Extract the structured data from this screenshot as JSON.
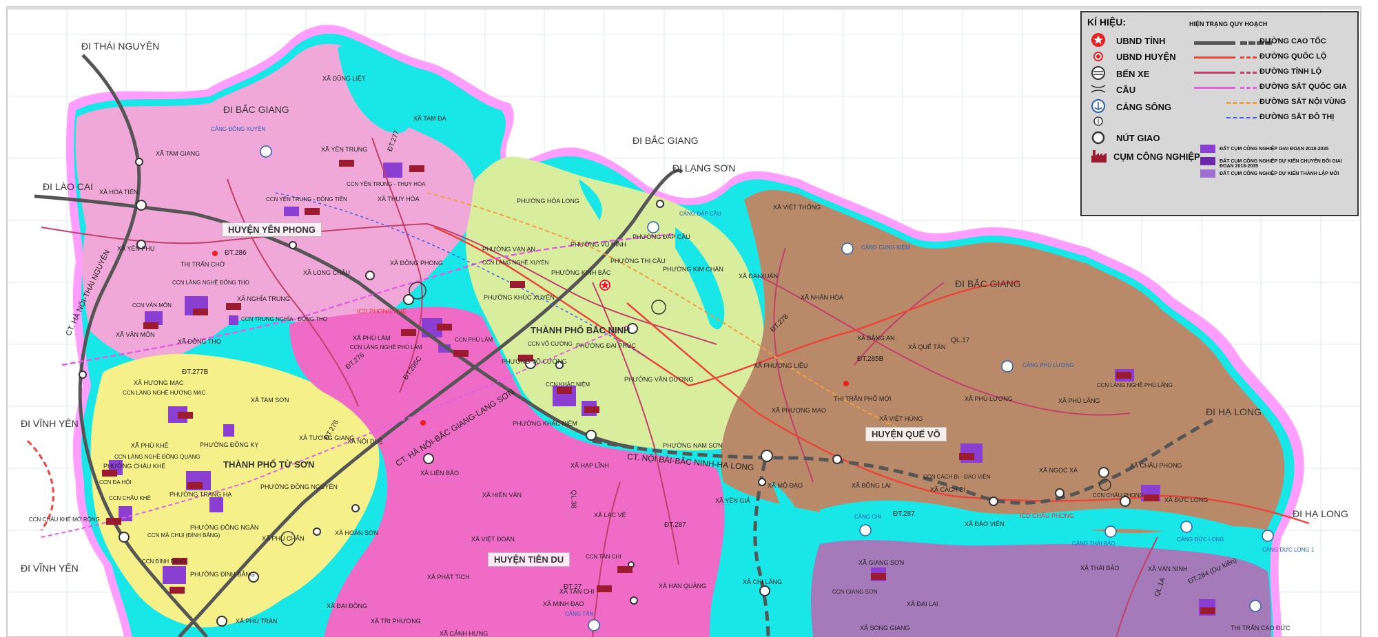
{
  "legend": {
    "title": "KÍ HIỆU:",
    "header": "HIỆN TRẠNG  QUY HOẠCH",
    "point_items": [
      {
        "label": "UBND TỈNH",
        "icon": "star-circle-icon"
      },
      {
        "label": "UBND HUYỆN",
        "icon": "red-dot-icon"
      },
      {
        "label": "BẾN XE",
        "icon": "bus-station-icon"
      },
      {
        "label": "CẦU",
        "icon": "bridge-icon"
      },
      {
        "label": "CẢNG SÔNG",
        "icon": "anchor-port-icon"
      },
      {
        "label": "",
        "icon": "small-port-icon"
      },
      {
        "label": "NÚT GIAO",
        "icon": "junction-circle-icon"
      },
      {
        "label": "CỤM CÔNG NGHIỆP",
        "icon": "factory-icon"
      }
    ],
    "line_items": [
      {
        "label": "ĐƯỜNG CAO TỐC",
        "color": "#555555"
      },
      {
        "label": "ĐƯỜNG QUỐC LỘ",
        "color": "#e8453c"
      },
      {
        "label": "ĐƯỜNG TỈNH LỘ",
        "color": "#c0406a"
      },
      {
        "label": "ĐƯỜNG SẮT QUỐC GIA",
        "color": "#e060e0"
      },
      {
        "label": "ĐƯỜNG SẮT NỘI VÙNG",
        "color": "#f0a040"
      },
      {
        "label": "ĐƯỜNG SẮT ĐÔ THỊ",
        "color": "#4060e0"
      }
    ],
    "area_items": [
      {
        "label": "ĐẤT CỤM CÔNG NGHIỆP GIAI ĐOẠN 2018-2035",
        "color": "#8a3fd0"
      },
      {
        "label": "ĐẤT CỤM CÔNG NGHIỆP DỰ KIẾN CHUYỂN ĐỔI GIAI ĐOẠN 2018-2035",
        "color": "#6a2aa8"
      },
      {
        "label": "ĐẤT CỤM CÔNG NGHIỆP DỰ KIẾN THÀNH LẬP MỚI",
        "color": "#a070d0"
      }
    ]
  },
  "directions": [
    "ĐI THÁI NGUYÊN",
    "ĐI BẮC GIANG",
    "ĐI BẮC GIANG",
    "ĐI LẠNG SƠN",
    "ĐI LÀO CAI",
    "ĐI BẮC GIANG",
    "ĐI VĨNH YÊN",
    "ĐI VĨNH YÊN",
    "ĐI HẠ LONG",
    "ĐI HẠ LONG"
  ],
  "districts": [
    "HUYỆN YÊN PHONG",
    "THÀNH PHỐ BẮC NINH",
    "THÀNH PHỐ TỪ SƠN",
    "HUYỆN QUẾ VÕ",
    "HUYỆN TIÊN DU"
  ],
  "communes": [
    "XÃ DŨNG LIỆT",
    "XÃ TAM ĐA",
    "XÃ YÊN TRUNG",
    "XÃ TAM GIANG",
    "XÃ HÒA TIẾN",
    "XÃ THỤY HÒA",
    "XÃ ĐÔNG PHONG",
    "XÃ YÊN PHỤ",
    "THỊ TRẤN CHỜ",
    "XÃ LONG CHÂU",
    "XÃ VĂN MÔN",
    "XÃ ĐÔNG THỌ",
    "XÃ NGHĨA TRUNG",
    "XÃ PHÚ LÂM",
    "XÃ HƯƠNG MẠC",
    "XÃ TAM SƠN",
    "XÃ TƯƠNG GIANG",
    "XÃ PHÙ KHÊ",
    "PHƯỜNG ĐỒNG KỴ",
    "PHƯỜNG CHÂU KHÊ",
    "PHƯỜNG TRANG HẠ",
    "PHƯỜNG ĐÔNG NGÀN",
    "PHƯỜNG ĐÌNH BẢNG",
    "PHƯỜNG ĐỒNG NGUYÊN",
    "XÃ PHÙ CHẨN",
    "XÃ HOÀN SƠN",
    "XÃ NỘI DUỆ",
    "XÃ LIÊN BÃO",
    "XÃ HIÊN VÂN",
    "XÃ VIỆT ĐOÀN",
    "XÃ PHẬT TÍCH",
    "XÃ LẠC VỆ",
    "XÃ ĐẠI ĐỒNG",
    "XÃ TRI PHƯƠNG",
    "XÃ CẢNH HƯNG",
    "XÃ MINH ĐẠO",
    "XÃ TÂN CHI",
    "XÃ HẠP LĨNH",
    "PHƯỜNG KHẮC NIỆM",
    "PHƯỜNG VÕ CƯỜNG",
    "PHƯỜNG VÂN DƯƠNG",
    "PHƯỜNG NAM SƠN",
    "PHƯỜNG ĐẠI PHÚC",
    "PHƯỜNG KINH BẮC",
    "PHƯỜNG VẠN AN",
    "PHƯỜNG HÒA LONG",
    "PHƯỜNG VŨ NINH",
    "PHƯỜNG THỊ CẦU",
    "PHƯỜNG ĐÁP CẦU",
    "PHƯỜNG KIM CHÂN",
    "PHƯỜNG KHÚC XUYÊN",
    "XÃ VIỆT THỐNG",
    "XÃ ĐẠI XUÂN",
    "XÃ NHÂN HÒA",
    "XÃ BẰNG AN",
    "XÃ QUẾ TÂN",
    "XÃ PHƯỢNG MAO",
    "XÃ PHƯƠNG LIỄU",
    "THỊ TRẤN PHỐ MỚI",
    "XÃ VIỆT HÙNG",
    "XÃ PHÙ LƯƠNG",
    "XÃ PHÚ LÃNG",
    "XÃ NGỌC XÁ",
    "XÃ CHÂU PHONG",
    "XÃ ĐỨC LONG",
    "XÃ MỘ ĐẠO",
    "XÃ BỒNG LAI",
    "XÃ CÁCH BI",
    "XÃ ĐÀO VIÊN",
    "XÃ YÊN GIẢ",
    "XÃ CHI LĂNG",
    "XÃ HÁN QUẢNG",
    "XÃ GIANG SƠN",
    "XÃ THÁI BẢO",
    "XÃ VẠN NINH",
    "XÃ ĐẠI LAI",
    "XÃ SONG GIANG",
    "THỊ TRẤN CAO ĐỨC",
    "XÃ PHÚ TRÀN"
  ],
  "clusters": [
    "CCN YÊN TRUNG - THỤY HÒA",
    "CCN YÊN TRUNG - ĐÔNG TIẾN",
    "CCN LÀNG NGHỀ ĐÔNG THỌ",
    "CCN VĂN MÔN",
    "CCN TRUNG NGHĨA - ĐÔNG THỌ",
    "CCN PHÚ LÂM",
    "CCN LÀNG NGHỀ PHÚ LÂM",
    "CCN LÀNG NGHỀ HƯƠNG MẠC",
    "CCN CHÂU KHÊ",
    "CCN ĐA HỘI",
    "CCN MẢ CHUI (ĐÌNH BẢNG)",
    "CCN ĐÌNH BẢNG",
    "CCN CHÂU KHÊ MỞ RỘNG",
    "CCN VÕ CƯỜNG",
    "CCN LÀNG NGHỀ XUYÊN",
    "CCN TÂN CHI",
    "CCN CÁCH BI - ĐÀO VIÊN",
    "CCN LÀNG NGHỀ PHÚ LÃNG",
    "CCN GIANG SƠN",
    "CCN CHÂU PHONG",
    "CCN LÀNG NGHỀ ĐỒNG QUANG",
    "CCN KHẮC NIỆM"
  ],
  "roads": [
    "ĐT.286",
    "ĐT.277B",
    "ĐT.276",
    "ĐT.295C",
    "ĐT.287",
    "ĐT.285B",
    "QL.17",
    "ĐT.278",
    "ĐT.287",
    "QL.38",
    "ĐT.276",
    "ĐT.27",
    "QL.1A",
    "ĐT.284 (Dự kiến)",
    "ĐT.277"
  ],
  "expressways": [
    "CT. HÀ NỘI-BẮC GIANG-LẠNG SƠN",
    "CT. HÀ NỘI-THÁI NGUYÊN",
    "CT. NỘI BÀI-BẮC NINH-HẠ LONG"
  ],
  "ports": [
    "CẢNG ĐÁP CẦU",
    "CẢNG CUNG KIỆM",
    "CẢNG PHÚ LƯƠNG",
    "CẢNG ĐỨC LONG",
    "CẢNG ĐỨC LONG 1",
    "CẢNG CHI",
    "CẢNG THÁI BẢO",
    "CẢNG TÂN",
    "CẢNG ĐÔNG XUYÊN"
  ],
  "icds": [
    "ICD PHONG KHÊ",
    "ICD CHÂU PHONG"
  ],
  "colors": {
    "water": "#19e6e6",
    "river_edge": "#ff9eff",
    "yen_phong": "#f0a8d8",
    "bac_ninh_city": "#d9ed9f",
    "tu_son": "#f5f08a",
    "tien_du": "#ee6cc6",
    "que_vo": "#b98a6a",
    "gia_binh": "#a47ab8",
    "industrial": "#8a3fd0",
    "expressway": "#555555"
  }
}
